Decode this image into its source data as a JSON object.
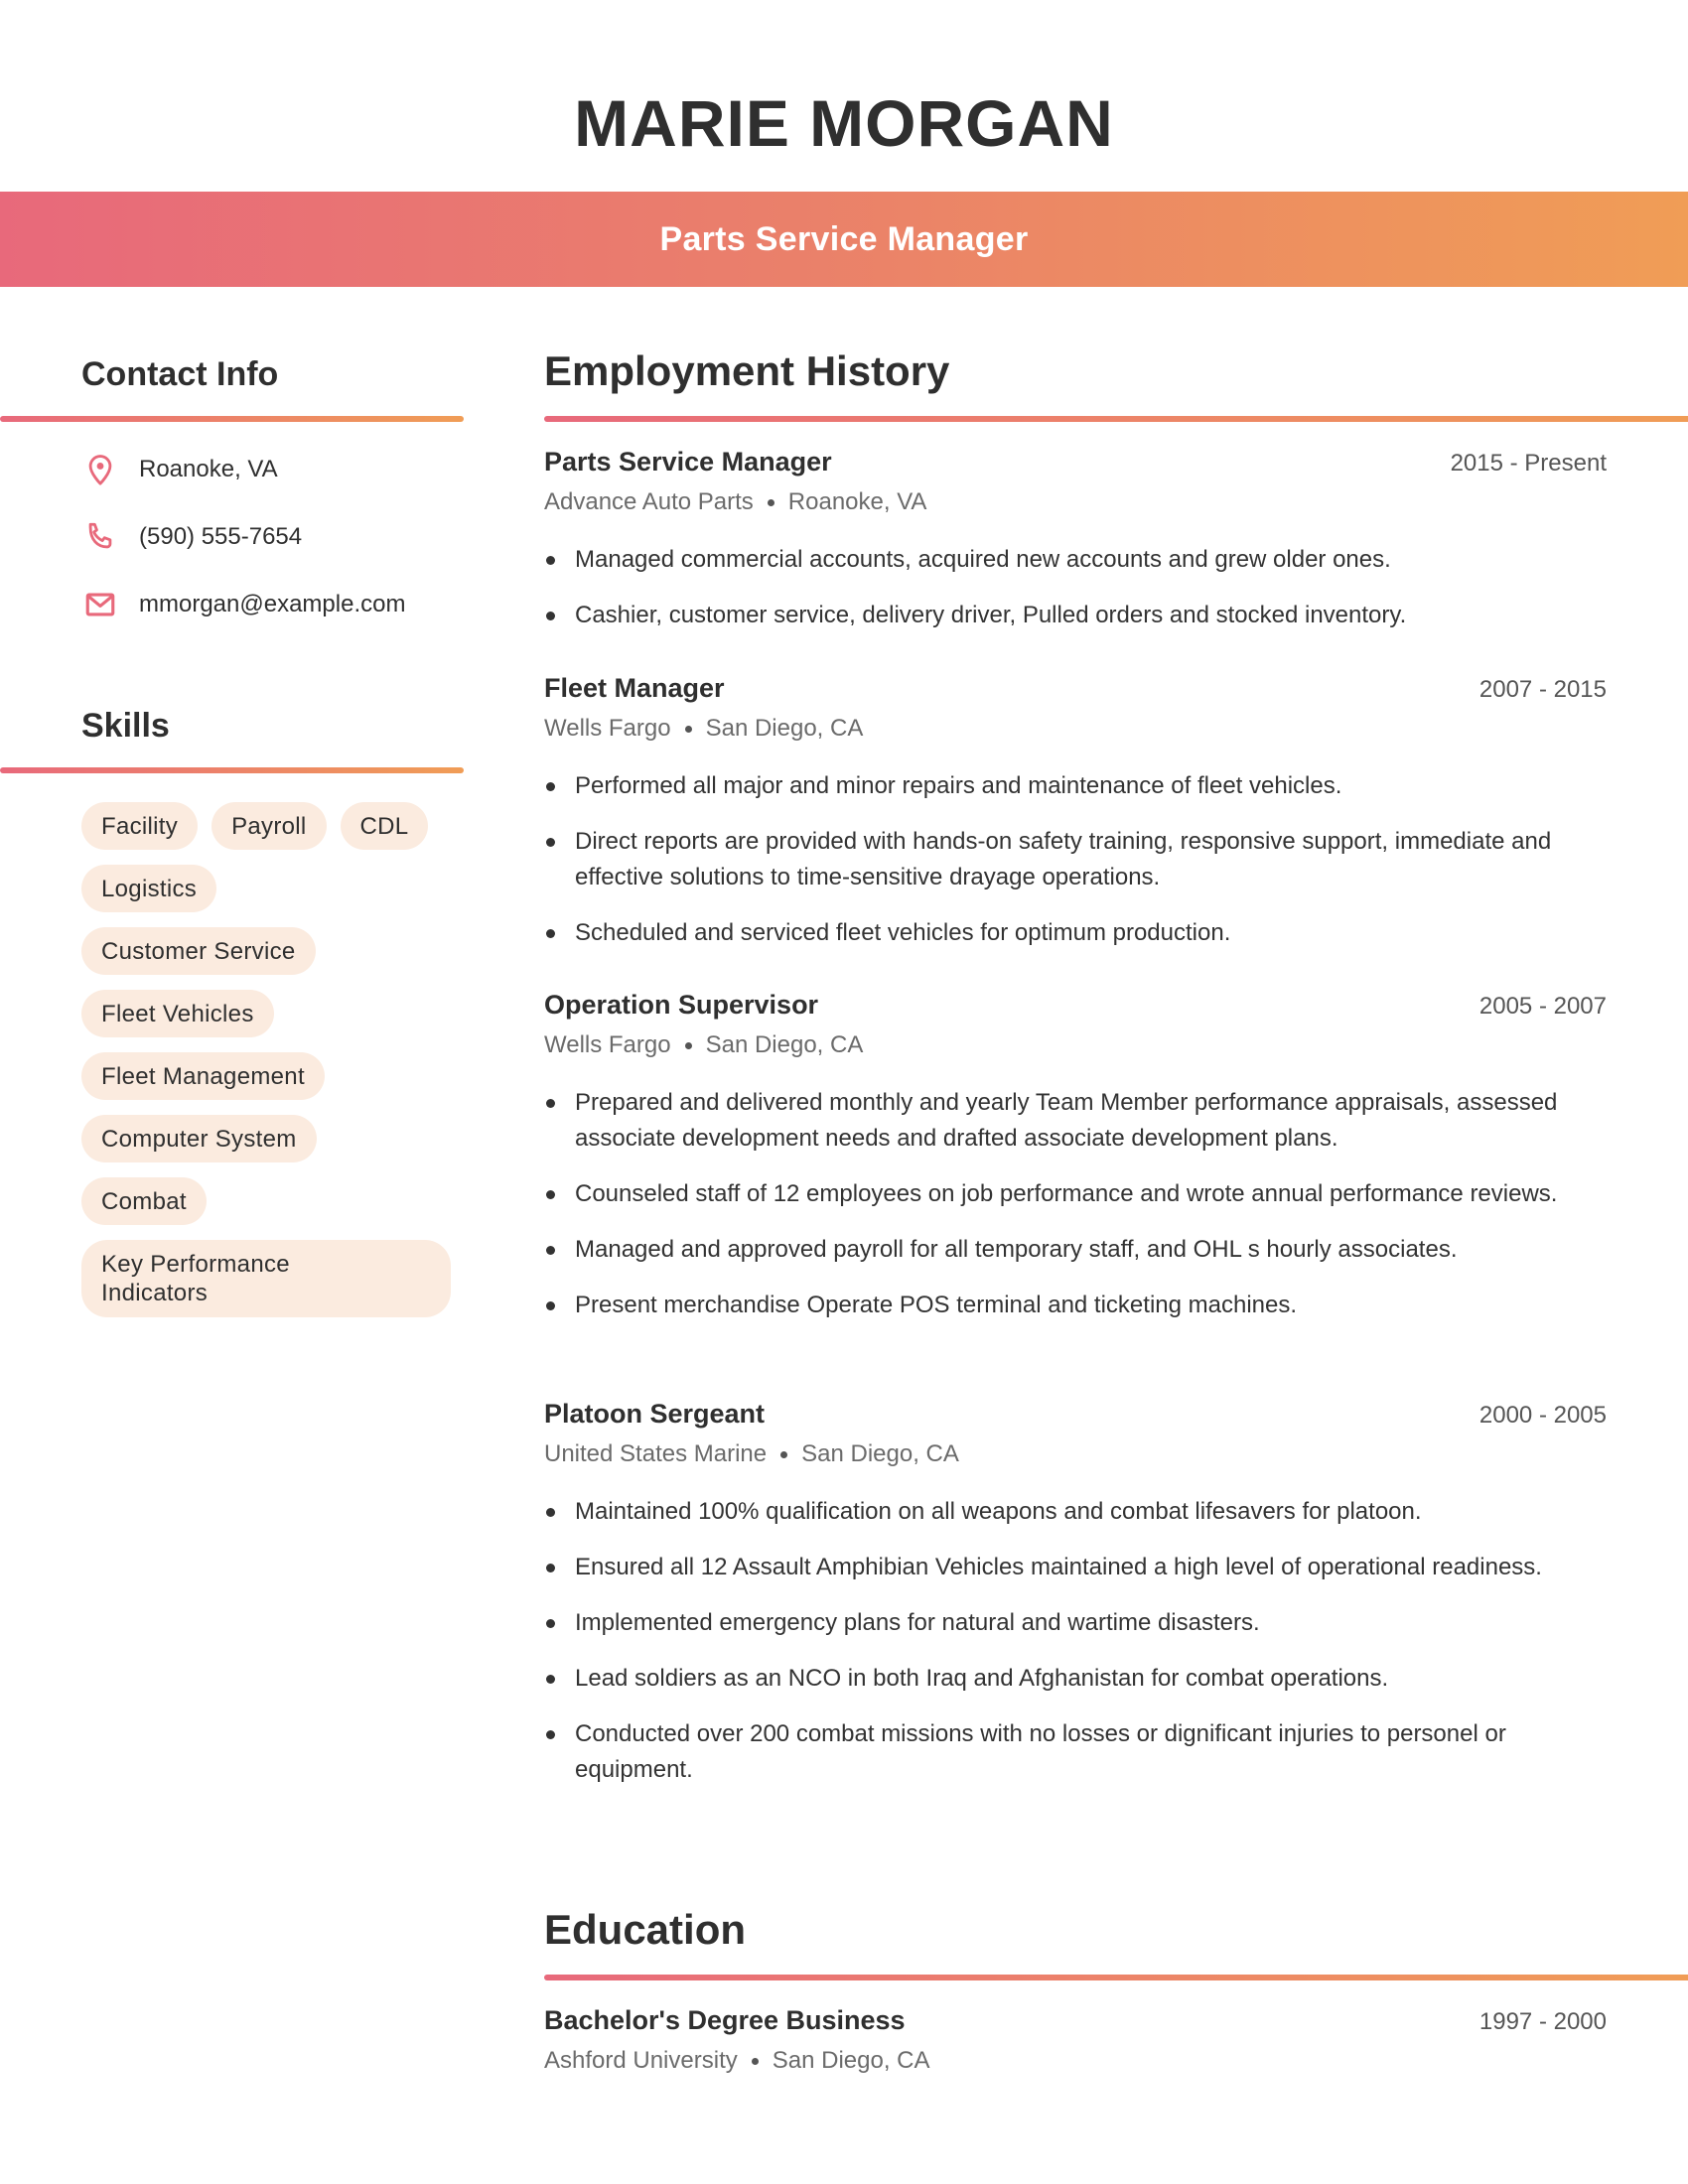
{
  "header": {
    "name": "MARIE MORGAN",
    "title": "Parts Service Manager"
  },
  "theme": {
    "gradient_start": "#e8697b",
    "gradient_end": "#f09d56",
    "chip_background": "#fbebdf",
    "icon_color": "#e8697b"
  },
  "contact": {
    "heading": "Contact Info",
    "items": [
      {
        "icon": "location-pin-icon",
        "text": "Roanoke, VA"
      },
      {
        "icon": "phone-icon",
        "text": "(590) 555-7654"
      },
      {
        "icon": "email-icon",
        "text": "mmorgan@example.com"
      }
    ]
  },
  "skills": {
    "heading": "Skills",
    "items": [
      "Facility",
      "Payroll",
      "CDL",
      "Logistics",
      "Customer Service",
      "Fleet Vehicles",
      "Fleet Management",
      "Computer System",
      "Combat",
      "Key Performance Indicators"
    ]
  },
  "employment": {
    "heading": "Employment History",
    "jobs": [
      {
        "title": "Parts Service Manager",
        "dates": "2015 - Present",
        "company": "Advance Auto Parts",
        "location": "Roanoke, VA",
        "bullets": [
          "Managed commercial accounts, acquired new accounts and grew older ones.",
          "Cashier, customer service, delivery driver, Pulled orders and stocked inventory."
        ]
      },
      {
        "title": "Fleet Manager",
        "dates": "2007 - 2015",
        "company": "Wells Fargo",
        "location": "San Diego, CA",
        "bullets": [
          "Performed all major and minor repairs and maintenance of fleet vehicles.",
          "Direct reports are provided with hands-on safety training, responsive support, immediate and effective solutions to time-sensitive drayage operations.",
          "Scheduled and serviced fleet vehicles for optimum production."
        ]
      },
      {
        "title": "Operation Supervisor",
        "dates": "2005 - 2007",
        "company": "Wells Fargo",
        "location": "San Diego, CA",
        "bullets": [
          "Prepared and delivered monthly and yearly Team Member performance appraisals, assessed associate development needs and drafted associate development plans.",
          "Counseled staff of 12 employees on job performance and wrote annual performance reviews.",
          "Managed and approved payroll for all temporary staff, and OHL s hourly associates.",
          "Present merchandise Operate POS terminal and ticketing machines."
        ]
      },
      {
        "title": "Platoon Sergeant",
        "dates": "2000 - 2005",
        "company": "United States Marine",
        "location": "San Diego, CA",
        "bullets": [
          "Maintained 100% qualification on all weapons and combat lifesavers for platoon.",
          "Ensured all 12 Assault Amphibian Vehicles maintained a high level of operational readiness.",
          "Implemented emergency plans for natural and wartime disasters.",
          "Lead soldiers as an NCO in both Iraq and Afghanistan for combat operations.",
          "Conducted over 200 combat missions with no losses or dignificant injuries to personel or equipment."
        ]
      }
    ]
  },
  "education": {
    "heading": "Education",
    "entries": [
      {
        "degree": "Bachelor's Degree Business",
        "dates": "1997 - 2000",
        "school": "Ashford University",
        "location": "San Diego, CA"
      }
    ]
  }
}
